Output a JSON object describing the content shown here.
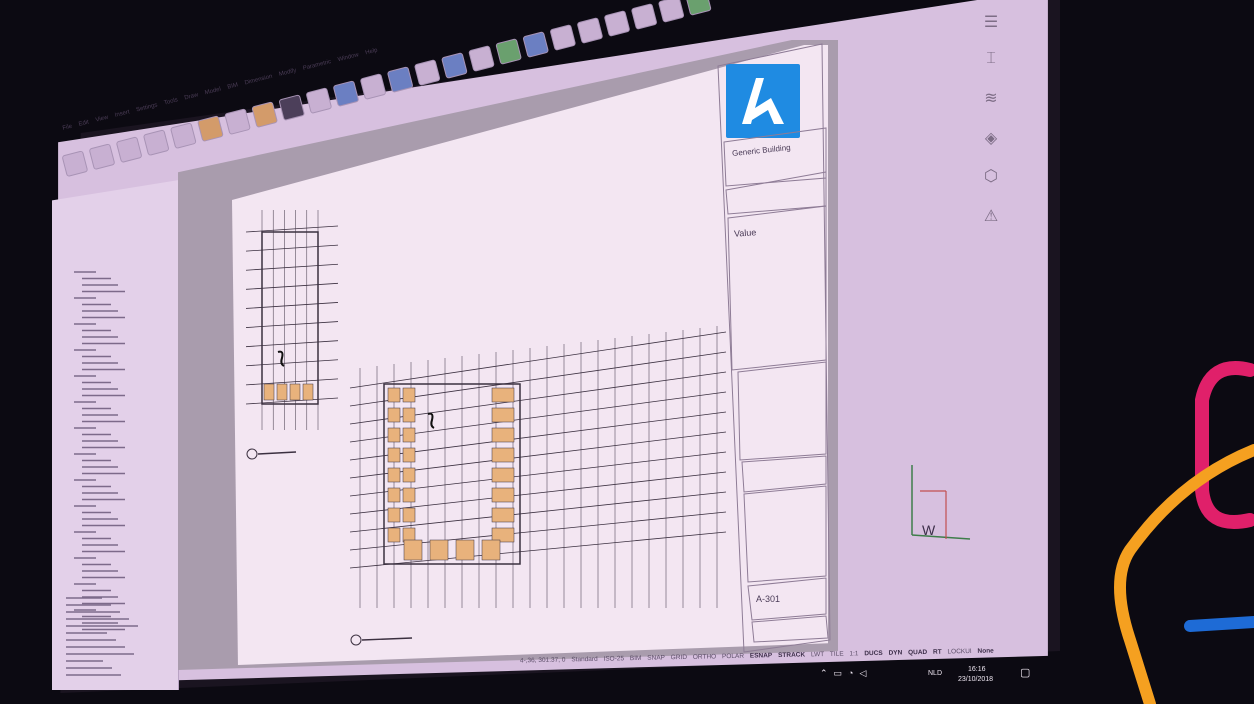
{
  "menu": {
    "items": [
      "File",
      "Edit",
      "View",
      "Insert",
      "Settings",
      "Tools",
      "Draw",
      "Model",
      "BIM",
      "Dimension",
      "Modify",
      "Parametric",
      "Window",
      "Help"
    ]
  },
  "title_block": {
    "project_name": "Generic Building",
    "field_value": "Value",
    "sheet_number": "A-301"
  },
  "statusbar": {
    "coords": "4-,36, 301.37, 0",
    "standard": "Standard",
    "iso": "ISO-25",
    "bim": "BIM",
    "toggles": [
      "SNAP",
      "GRID",
      "ORTHO",
      "POLAR",
      "ESNAP",
      "STRACK",
      "LWT",
      "TILE",
      "1:1",
      "DUCS",
      "DYN",
      "QUAD",
      "RT",
      "LOCKUI"
    ],
    "toggles_on": [
      "ESNAP",
      "STRACK",
      "DUCS",
      "DYN",
      "QUAD",
      "RT"
    ],
    "scale": "None"
  },
  "taskbar": {
    "language": "NLD",
    "time": "16:16",
    "date": "23/10/2018"
  },
  "colors": {
    "screen_bg": "#d7c0df",
    "sheet_bg": "#f3e6f2",
    "logo_blue": "#1f8be2",
    "window_fill": "#e8b27c",
    "grid_line": "#3b3040",
    "neon_pink": "#e0206a",
    "neon_orange": "#f5a020",
    "neon_blue": "#1e6bd6"
  },
  "icons": {
    "right_bar": [
      "properties-icon",
      "structure-icon",
      "sliders-icon",
      "layers-icon",
      "components-icon",
      "warning-icon"
    ],
    "logo": "bricscad-logo-icon"
  }
}
